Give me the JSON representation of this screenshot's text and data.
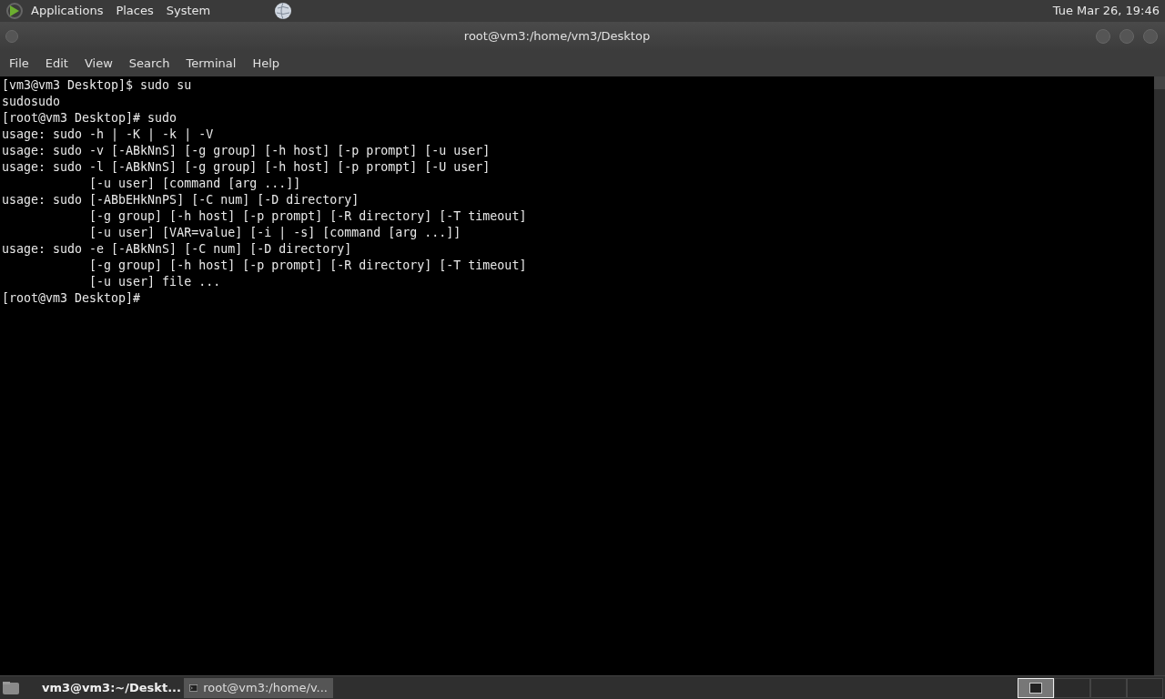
{
  "top_panel": {
    "menus": [
      "Applications",
      "Places",
      "System"
    ],
    "clock": "Tue Mar 26, 19:46"
  },
  "window": {
    "title": "root@vm3:/home/vm3/Desktop"
  },
  "menu_bar": [
    "File",
    "Edit",
    "View",
    "Search",
    "Terminal",
    "Help"
  ],
  "terminal": {
    "lines": [
      "[vm3@vm3 Desktop]$ sudo su",
      "sudosudo",
      "[root@vm3 Desktop]# sudo",
      "usage: sudo -h | -K | -k | -V",
      "usage: sudo -v [-ABkNnS] [-g group] [-h host] [-p prompt] [-u user]",
      "usage: sudo -l [-ABkNnS] [-g group] [-h host] [-p prompt] [-U user]",
      "            [-u user] [command [arg ...]]",
      "usage: sudo [-ABbEHkNnPS] [-C num] [-D directory]",
      "            [-g group] [-h host] [-p prompt] [-R directory] [-T timeout]",
      "            [-u user] [VAR=value] [-i | -s] [command [arg ...]]",
      "usage: sudo -e [-ABkNnS] [-C num] [-D directory]",
      "            [-g group] [-h host] [-p prompt] [-R directory] [-T timeout]",
      "            [-u user] file ...",
      "[root@vm3 Desktop]#"
    ]
  },
  "taskbar": {
    "tasks": [
      {
        "label": "vm3@vm3:~/Deskt...",
        "selected": false,
        "urgent": true
      },
      {
        "label": "root@vm3:/home/v...",
        "selected": true,
        "urgent": false
      }
    ],
    "workspaces": [
      {
        "selected": true
      },
      {
        "selected": false
      },
      {
        "selected": false
      },
      {
        "selected": false
      }
    ]
  }
}
